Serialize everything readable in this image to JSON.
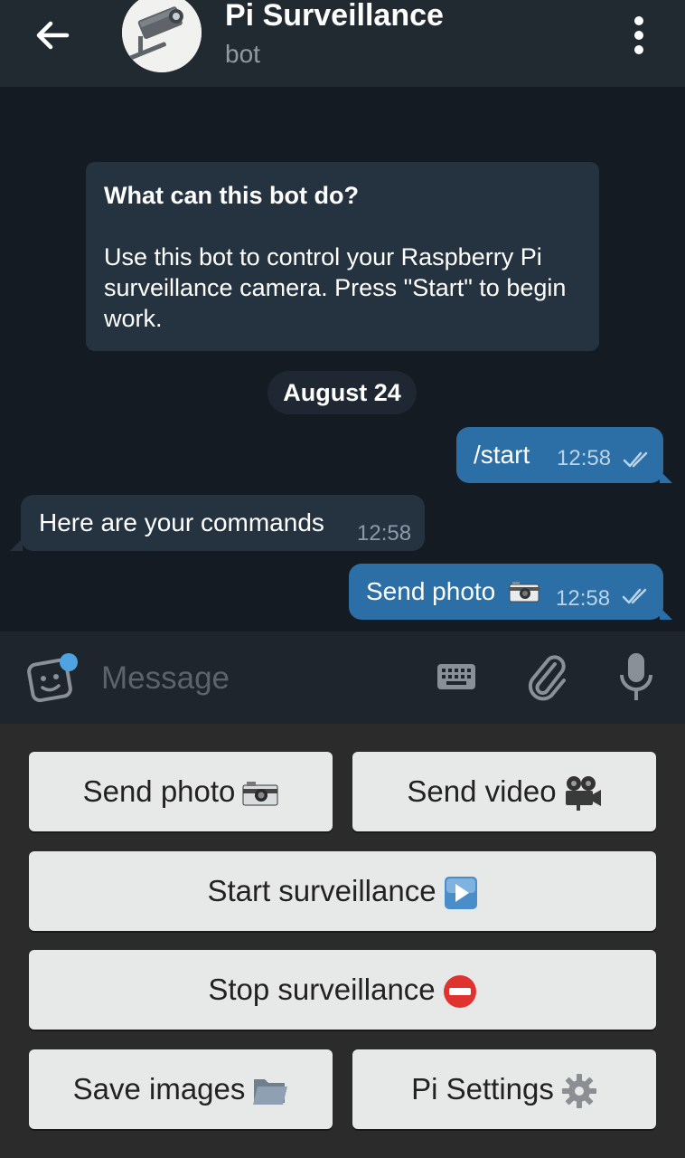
{
  "header": {
    "title": "Pi Surveillance",
    "subtitle": "bot"
  },
  "chat": {
    "info_card": {
      "title": "What can this bot do?",
      "text": "Use this bot to control your Raspberry Pi surveillance camera. Press \"Start\" to begin work."
    },
    "date": "August 24",
    "messages": [
      {
        "direction": "out",
        "text": "/start",
        "time": "12:58",
        "status": "read"
      },
      {
        "direction": "in",
        "text": "Here are your commands",
        "time": "12:58"
      },
      {
        "direction": "out",
        "text": "Send photo",
        "emoji": "camera-icon",
        "time": "12:58",
        "status": "read"
      }
    ]
  },
  "input": {
    "placeholder": "Message"
  },
  "keyboard": {
    "send_photo": "Send photo",
    "send_video": "Send video",
    "start_surveillance": "Start surveillance",
    "stop_surveillance": "Stop surveillance",
    "save_images": "Save images",
    "pi_settings": "Pi Settings"
  },
  "colors": {
    "header_bg": "#222a31",
    "chat_bg": "#151b22",
    "outgoing_bubble": "#2b6fa6",
    "incoming_bubble": "#253341",
    "keyboard_bg": "#2b2b2b",
    "keyboard_button": "#e7e8e8",
    "accent_dot": "#4fa3e0"
  }
}
